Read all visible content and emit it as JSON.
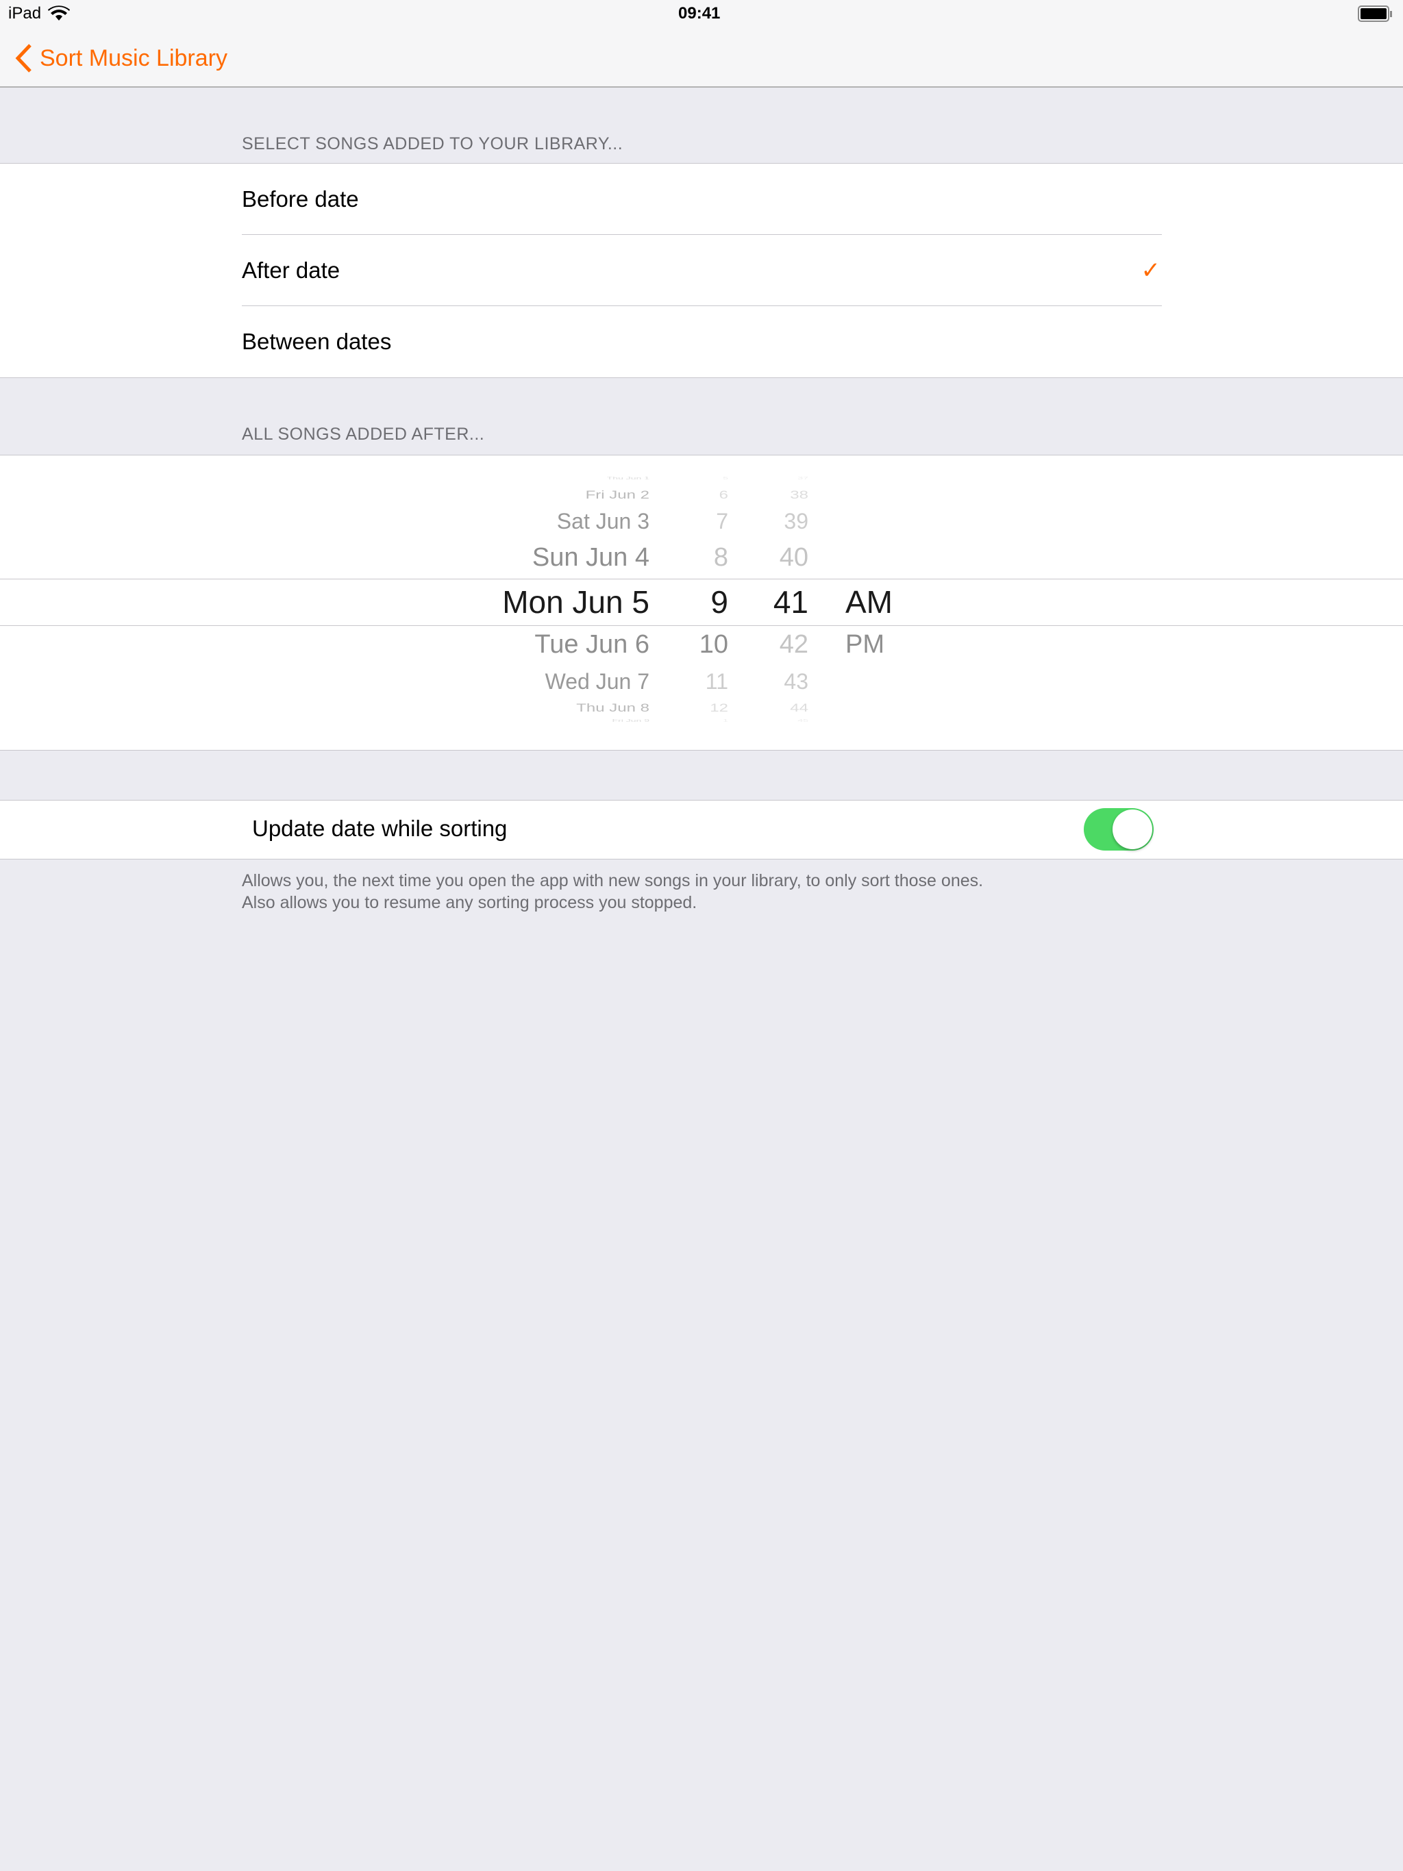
{
  "status_bar": {
    "device": "iPad",
    "time": "09:41",
    "wifi_icon": "wifi-icon",
    "battery_icon": "battery-icon"
  },
  "nav": {
    "back_label": "Sort Music Library",
    "accent": "#ff6a00"
  },
  "section1": {
    "header": "SELECT SONGS ADDED TO YOUR LIBRARY...",
    "options": [
      {
        "label": "Before date",
        "selected": false
      },
      {
        "label": "After date",
        "selected": true
      },
      {
        "label": "Between dates",
        "selected": false
      }
    ],
    "check": "✓"
  },
  "section2": {
    "header": "ALL SONGS ADDED AFTER...",
    "picker": {
      "dates": [
        "Thu Jun 1",
        "Fri Jun 2",
        "Sat Jun 3",
        "Sun Jun 4",
        "Mon Jun 5",
        "Tue Jun 6",
        "Wed Jun 7",
        "Thu Jun 8",
        "Fri Jun 9"
      ],
      "hours": [
        "5",
        "6",
        "7",
        "8",
        "9",
        "10",
        "11",
        "12",
        "1"
      ],
      "minutes": [
        "37",
        "38",
        "39",
        "40",
        "41",
        "42",
        "43",
        "44",
        "45"
      ],
      "periods": [
        "AM",
        "PM"
      ],
      "selected": {
        "date": "Mon Jun 5",
        "hour": "9",
        "minute": "41",
        "period": "AM"
      }
    }
  },
  "section3": {
    "toggle_label": "Update date while sorting",
    "toggle_on": true,
    "toggle_color": "#4cd964",
    "footer_lines": [
      "Allows you, the next time you open the app with new songs in your library, to only sort those ones.",
      "Also allows you to resume any sorting process you stopped."
    ]
  }
}
